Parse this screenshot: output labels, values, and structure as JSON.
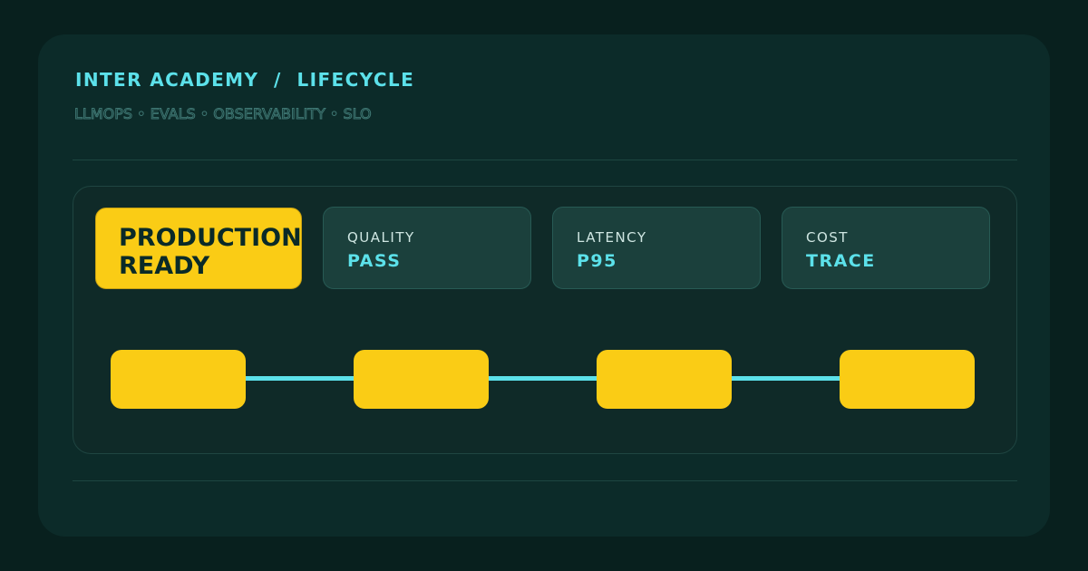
{
  "header": {
    "title": "INTER ACADEMY  /  LIFECYCLE",
    "subtitle": "LLMOPS • EVALS • OBSERVABILITY • SLO"
  },
  "badge": {
    "text": "PRODUCTION\nREADY"
  },
  "stats": [
    {
      "label": "QUALITY",
      "value": "PASS"
    },
    {
      "label": "LATENCY",
      "value": "P95"
    },
    {
      "label": "COST",
      "value": "TRACE"
    }
  ],
  "colors": {
    "background": "#08201e",
    "card": "#0c2b29",
    "accent_cyan": "#5ce1ea",
    "accent_yellow": "#facc15"
  }
}
